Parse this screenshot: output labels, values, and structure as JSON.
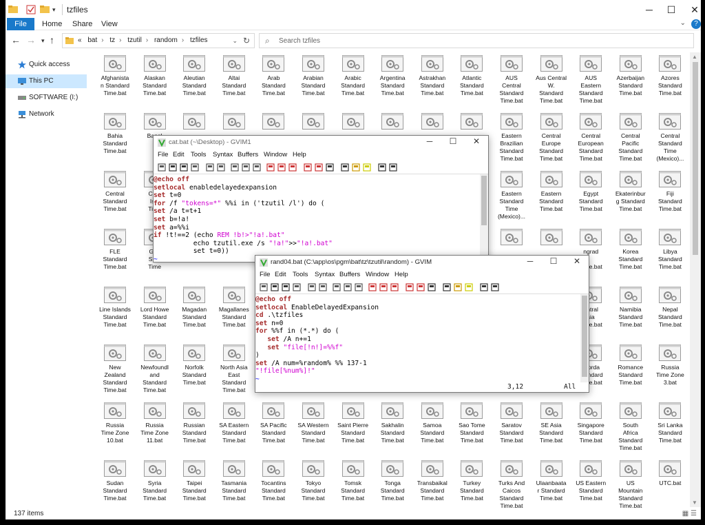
{
  "window": {
    "title": "tzfiles"
  },
  "ribbon": {
    "tabs": [
      "File",
      "Home",
      "Share",
      "View"
    ]
  },
  "address": {
    "crumbs": [
      "«",
      "bat",
      "tz",
      "tzutil",
      "random",
      "tzfiles"
    ]
  },
  "search": {
    "placeholder": "Search tzfiles"
  },
  "nav": {
    "items": [
      "Quick access",
      "This PC",
      "SOFTWARE (I:)",
      "Network"
    ]
  },
  "status": {
    "count": "137 items"
  },
  "files": [
    [
      "Afghanista",
      "n Standard",
      "Time.bat"
    ],
    [
      "Alaskan",
      "Standard",
      "Time.bat"
    ],
    [
      "Aleutian",
      "Standard",
      "Time.bat"
    ],
    [
      "Altai",
      "Standard",
      "Time.bat"
    ],
    [
      "Arab",
      "Standard",
      "Time.bat"
    ],
    [
      "Arabian",
      "Standard",
      "Time.bat"
    ],
    [
      "Arabic",
      "Standard",
      "Time.bat"
    ],
    [
      "Argentina",
      "Standard",
      "Time.bat"
    ],
    [
      "Astrakhan",
      "Standard",
      "Time.bat"
    ],
    [
      "Atlantic",
      "Standard",
      "Time.bat"
    ],
    [
      "AUS",
      "Central",
      "Standard",
      "Time.bat"
    ],
    [
      "Aus Central",
      "W.",
      "Standard",
      "Time.bat"
    ],
    [
      "AUS",
      "Eastern",
      "Standard",
      "Time.bat"
    ],
    [
      "Azerbaijan",
      "Standard",
      "Time.bat"
    ],
    [
      "Azores",
      "Standard",
      "Time.bat"
    ],
    [
      "Bahia",
      "Standard",
      "Time.bat"
    ],
    [
      "Bangl"
    ],
    [],
    [],
    [],
    [],
    [],
    [],
    [],
    [],
    [
      "Eastern",
      "Brazilian",
      "Standard",
      "Time.bat"
    ],
    [
      "Central",
      "Europe",
      "Standard",
      "Time.bat"
    ],
    [
      "Central",
      "European",
      "Standard",
      "Time.bat"
    ],
    [
      "Central",
      "Pacific",
      "Standard",
      "Time.bat"
    ],
    [
      "Central",
      "Standard",
      "Time",
      "(Mexico)..."
    ],
    [
      "Central",
      "Standard",
      "Time.bat"
    ],
    [
      "Chat",
      "Isla",
      "Time"
    ],
    [],
    [],
    [],
    [],
    [],
    [],
    [],
    [],
    [
      "Eastern",
      "Standard",
      "Time",
      "(Mexico)..."
    ],
    [
      "Eastern",
      "Standard",
      "Time.bat"
    ],
    [
      "Egypt",
      "Standard",
      "Time.bat"
    ],
    [
      "Ekaterinbur",
      "g Standard",
      "Time.bat"
    ],
    [
      "Fiji",
      "Standard",
      "Time.bat"
    ],
    [
      "FLE",
      "Standard",
      "Time.bat"
    ],
    [
      "Geo",
      "Stan",
      "Time"
    ],
    [
      "Time.bat"
    ],
    [
      "Time.bat"
    ],
    [],
    [],
    [],
    [],
    [],
    [],
    [],
    [],
    [
      "ngrad",
      "",
      "Time.bat"
    ],
    [
      "Korea",
      "Standard",
      "Time.bat"
    ],
    [
      "Libya",
      "Standard",
      "Time.bat"
    ],
    [
      "Line Islands",
      "Standard",
      "Time.bat"
    ],
    [
      "Lord Howe",
      "Standard",
      "Time.bat"
    ],
    [
      "Magadan",
      "Standard",
      "Time.bat"
    ],
    [
      "Magallanes",
      "Standard",
      "Time.bat"
    ],
    [],
    [],
    [],
    [],
    [],
    [],
    [],
    [],
    [
      "entral",
      "sia",
      "Time.bat"
    ],
    [
      "Namibia",
      "Standard",
      "Time.bat"
    ],
    [
      "Nepal",
      "Standard",
      "Time.bat"
    ],
    [
      "New",
      "Zealand",
      "Standard",
      "Time.bat"
    ],
    [
      "Newfoundl",
      "and",
      "Standard",
      "Time.bat"
    ],
    [
      "Norfolk",
      "Standard",
      "Time.bat"
    ],
    [
      "North Asia",
      "East",
      "Standard",
      "Time.bat"
    ],
    [],
    [],
    [],
    [],
    [],
    [],
    [],
    [],
    [
      "ʻolorda",
      "Standard",
      "Time.bat"
    ],
    [
      "Romance",
      "Standard",
      "Time.bat"
    ],
    [
      "Russia",
      "Time Zone",
      "3.bat"
    ],
    [
      "Russia",
      "Time Zone",
      "10.bat"
    ],
    [
      "Russia",
      "Time Zone",
      "11.bat"
    ],
    [
      "Russian",
      "Standard",
      "Time.bat"
    ],
    [
      "SA Eastern",
      "Standard",
      "Time.bat"
    ],
    [
      "SA Pacific",
      "Standard",
      "Time.bat"
    ],
    [
      "SA Western",
      "Standard",
      "Time.bat"
    ],
    [
      "Saint Pierre",
      "Standard",
      "Time.bat"
    ],
    [
      "Sakhalin",
      "Standard",
      "Time.bat"
    ],
    [
      "Samoa",
      "Standard",
      "Time.bat"
    ],
    [
      "Sao Tome",
      "Standard",
      "Time.bat"
    ],
    [
      "Saratov",
      "Standard",
      "Time.bat"
    ],
    [
      "SE Asia",
      "Standard",
      "Time.bat"
    ],
    [
      "Singapore",
      "Standard",
      "Time.bat"
    ],
    [
      "South",
      "Africa",
      "Standard",
      "Time.bat"
    ],
    [
      "Sri Lanka",
      "Standard",
      "Time.bat"
    ],
    [
      "Sudan",
      "Standard",
      "Time.bat"
    ],
    [
      "Syria",
      "Standard",
      "Time.bat"
    ],
    [
      "Taipei",
      "Standard",
      "Time.bat"
    ],
    [
      "Tasmania",
      "Standard",
      "Time.bat"
    ],
    [
      "Tocantins",
      "Standard",
      "Time.bat"
    ],
    [
      "Tokyo",
      "Standard",
      "Time.bat"
    ],
    [
      "Tomsk",
      "Standard",
      "Time.bat"
    ],
    [
      "Tonga",
      "Standard",
      "Time.bat"
    ],
    [
      "Transbaikal",
      "Standard",
      "Time.bat"
    ],
    [
      "Turkey",
      "Standard",
      "Time.bat"
    ],
    [
      "Turks And",
      "Caicos",
      "Standard",
      "Time.bat"
    ],
    [
      "Ulaanbaata",
      "r Standard",
      "Time.bat"
    ],
    [
      "US Eastern",
      "Standard",
      "Time.bat"
    ],
    [
      "US",
      "Mountain",
      "Standard",
      "Time.bat"
    ],
    [
      "UTC.bat"
    ]
  ],
  "gvim1": {
    "title": "cat.bat (~\\Desktop) - GVIM1",
    "menu": [
      "File",
      "Edit",
      "Tools",
      "Syntax",
      "Buffers",
      "Window",
      "Help"
    ],
    "lines": [
      [
        {
          "t": "@echo ",
          "c": "kw"
        },
        {
          "t": "off",
          "c": "kw"
        }
      ],
      [
        {
          "t": "setlocal",
          "c": "kw"
        },
        {
          "t": " enabledelayedexpansion",
          "c": ""
        }
      ],
      [
        {
          "t": "set",
          "c": "kw"
        },
        {
          "t": " t=0",
          "c": ""
        }
      ],
      [
        {
          "t": "for",
          "c": "kw"
        },
        {
          "t": " /f ",
          "c": ""
        },
        {
          "t": "\"tokens=*\"",
          "c": "st"
        },
        {
          "t": " %%i in ('tzutil /l') do (",
          "c": ""
        }
      ],
      [
        {
          "t": "set",
          "c": "kw"
        },
        {
          "t": " /a t=t+1",
          "c": ""
        }
      ],
      [
        {
          "t": "set",
          "c": "kw"
        },
        {
          "t": " b=!a!",
          "c": ""
        }
      ],
      [
        {
          "t": "set",
          "c": "kw"
        },
        {
          "t": " a=%%i",
          "c": ""
        }
      ],
      [
        {
          "t": "if",
          "c": "kw"
        },
        {
          "t": " !t!==2 (echo ",
          "c": ""
        },
        {
          "t": "REM !b!",
          "c": "st"
        },
        {
          "t": ">\"!a!.bat\"",
          "c": "st"
        }
      ],
      [
        {
          "t": "          echo tzutil.exe /s ",
          "c": ""
        },
        {
          "t": "\"!a!\"",
          "c": "st"
        },
        {
          "t": ">>",
          "c": ""
        },
        {
          "t": "\"!a!.bat\"",
          "c": "st"
        }
      ],
      [
        {
          "t": "          set t=0))",
          "c": ""
        }
      ],
      [
        {
          "t": "~",
          "c": "tl"
        }
      ]
    ]
  },
  "gvim2": {
    "title": "rand04.bat (C:\\app\\os\\pgm\\bat\\tz\\tzutil\\random) - GVIM",
    "menu": [
      "File",
      "Edit",
      "Tools",
      "Syntax",
      "Buffers",
      "Window",
      "Help"
    ],
    "lines": [
      [
        {
          "t": "@echo ",
          "c": "kw"
        },
        {
          "t": "off",
          "c": "kw"
        }
      ],
      [
        {
          "t": "setlocal",
          "c": "kw"
        },
        {
          "t": " EnableDelayedExpansion",
          "c": ""
        }
      ],
      [
        {
          "t": "cd",
          "c": "kw"
        },
        {
          "t": " .\\tzfiles",
          "c": ""
        }
      ],
      [
        {
          "t": "set",
          "c": "kw"
        },
        {
          "t": " n=0",
          "c": ""
        }
      ],
      [
        {
          "t": "for",
          "c": "kw"
        },
        {
          "t": " %%f in (*.*) do (",
          "c": ""
        }
      ],
      [
        {
          "t": "   set",
          "c": "kw"
        },
        {
          "t": " /A n+=1",
          "c": ""
        }
      ],
      [
        {
          "t": "   set",
          "c": "kw"
        },
        {
          "t": " ",
          "c": ""
        },
        {
          "t": "\"file[!n!]=%%f\"",
          "c": "st"
        }
      ],
      [
        {
          "t": ")",
          "c": ""
        }
      ],
      [
        {
          "t": "set",
          "c": "kw"
        },
        {
          "t": " /A num=%random% %% 137-1",
          "c": ""
        }
      ],
      [
        {
          "t": "\"!file[%num%]!\"",
          "c": "st"
        }
      ],
      [
        {
          "t": "~",
          "c": "tl"
        }
      ]
    ],
    "status_pos": "3,12",
    "status_all": "All"
  }
}
